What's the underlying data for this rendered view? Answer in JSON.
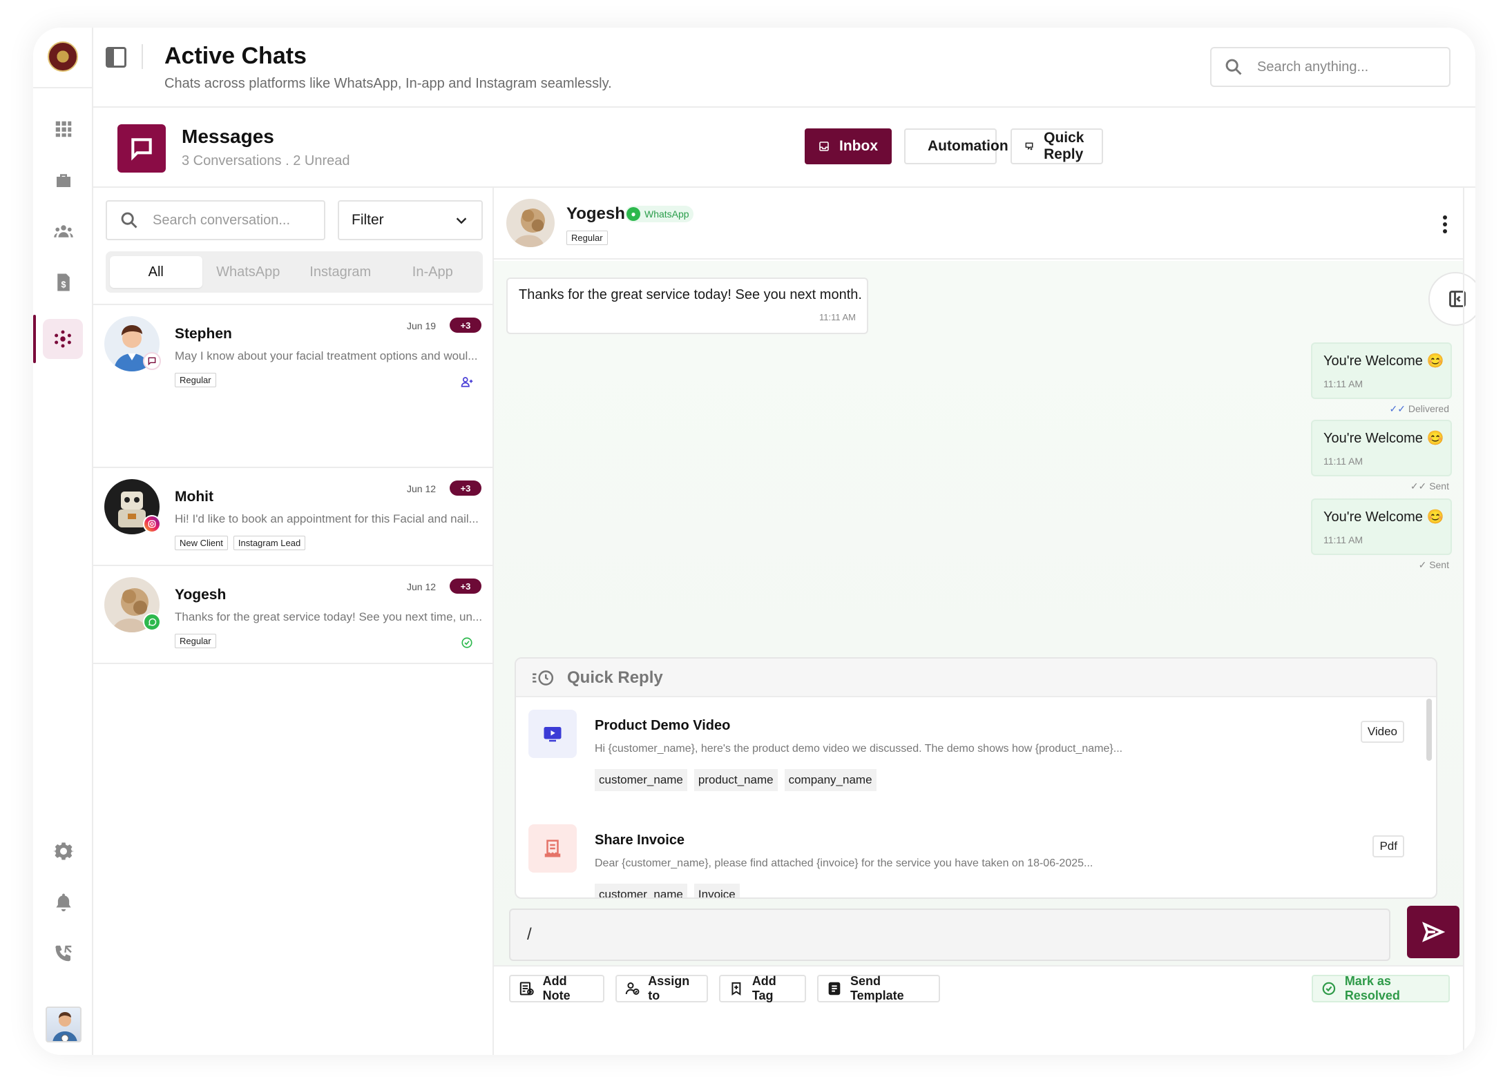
{
  "header": {
    "title": "Active Chats",
    "subtitle": "Chats across platforms like WhatsApp, In-app and Instagram seamlessly.",
    "search_placeholder": "Search anything..."
  },
  "messages_bar": {
    "title": "Messages",
    "summary": "3 Conversations . 2 Unread",
    "buttons": {
      "inbox": "Inbox",
      "automation": "Automation",
      "quick_reply": "Quick Reply"
    }
  },
  "conversation_list": {
    "search_placeholder": "Search conversation...",
    "filter_label": "Filter",
    "tabs": [
      "All",
      "WhatsApp",
      "Instagram",
      "In-App"
    ],
    "active_tab": "All",
    "items": [
      {
        "name": "Stephen",
        "date": "Jun 19",
        "count": "+3",
        "preview": "May I know about your facial treatment options and woul...",
        "tags": [
          "Regular"
        ],
        "channel": "in-app",
        "status_icon": "assign-icon"
      },
      {
        "name": "Mohit",
        "date": "Jun 12",
        "count": "+3",
        "preview": "Hi! I'd like to book an appointment for this Facial and nail...",
        "tags": [
          "New Client",
          "Instagram Lead"
        ],
        "channel": "instagram",
        "status_icon": ""
      },
      {
        "name": "Yogesh",
        "date": "Jun 12",
        "count": "+3",
        "preview": "Thanks for the great service today! See you next time, un...",
        "tags": [
          "Regular"
        ],
        "channel": "whatsapp",
        "status_icon": "resolved-icon"
      }
    ]
  },
  "chat": {
    "contact_name": "Yogesh",
    "channel_label": "WhatsApp",
    "contact_tag": "Regular",
    "messages": [
      {
        "direction": "in",
        "text": "Thanks for the great service today! See you next month.",
        "time": "11:11 AM"
      },
      {
        "direction": "out",
        "text": "You're Welcome 😊",
        "time": "11:11 AM",
        "status": "Delivered"
      },
      {
        "direction": "out",
        "text": "You're Welcome 😊",
        "time": "11:11 AM",
        "status": "Sent"
      },
      {
        "direction": "out",
        "text": "You're Welcome 😊",
        "time": "11:11 AM",
        "status": "Sent"
      }
    ]
  },
  "quick_reply": {
    "title": "Quick Reply",
    "items": [
      {
        "title": "Product Demo Video",
        "description": "Hi {customer_name}, here's the product demo video we discussed. The demo shows how {product_name}...",
        "variables": [
          "customer_name",
          "product_name",
          "company_name"
        ],
        "type": "Video",
        "icon": "video-icon",
        "icon_bg": "#eef0fb",
        "icon_color": "#3b3bd6"
      },
      {
        "title": "Share Invoice",
        "description": "Dear {customer_name}, please find attached {invoice} for the service you have taken on 18-06-2025...",
        "variables": [
          "customer_name",
          "Invoice"
        ],
        "type": "Pdf",
        "icon": "invoice-icon",
        "icon_bg": "#fde9e7",
        "icon_color": "#e57368"
      }
    ]
  },
  "composer": {
    "input_value": "/",
    "actions": {
      "add_note": "Add Note",
      "assign_to": "Assign to",
      "add_tag": "Add Tag",
      "send_template": "Send Template"
    },
    "resolve_label": "Mark as Resolved"
  },
  "colors": {
    "brand": "#6d0a36",
    "whatsapp": "#2db84d",
    "success": "#2e9a48"
  }
}
